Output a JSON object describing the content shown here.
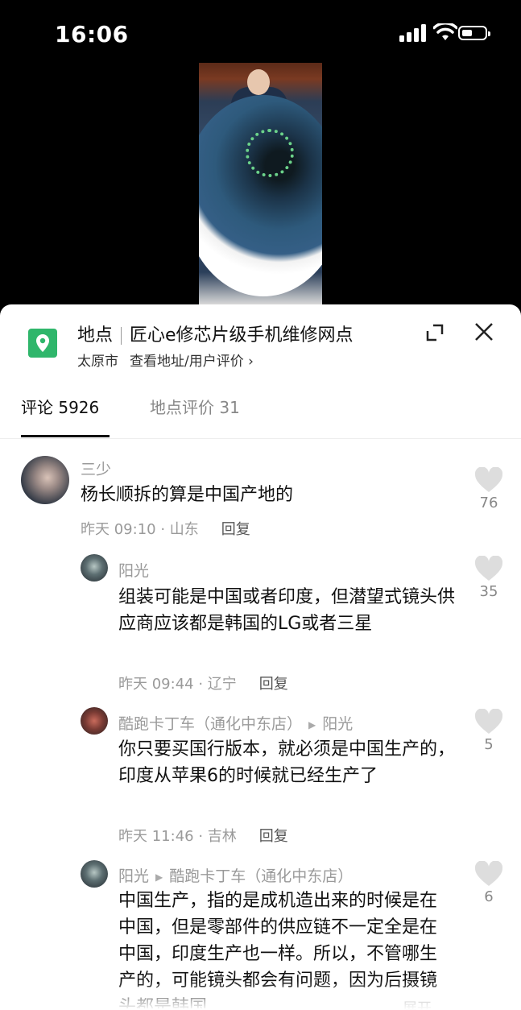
{
  "status_bar": {
    "time": "16:06"
  },
  "location": {
    "prefix": "地点",
    "name": "匠心e修芯片级手机维修网点",
    "city": "太原市",
    "link": "查看地址/用户评价",
    "link_chevron": "›"
  },
  "tabs": [
    {
      "label": "评论 5926"
    },
    {
      "label": "地点评价 31"
    }
  ],
  "comments": [
    {
      "user": "三少",
      "text": "杨长顺拆的算是中国产地的",
      "time_place": "昨天 09:10 · 山东",
      "reply": "回复",
      "likes": "76"
    },
    {
      "user": "阳光",
      "text": "组装可能是中国或者印度，但潜望式镜头供应商应该都是韩国的LG或者三星",
      "time_place": "昨天 09:44 · 辽宁",
      "reply": "回复",
      "likes": "35"
    },
    {
      "user": "酷跑卡丁车（通化中东店）",
      "reply_to": "阳光",
      "text": "你只要买国行版本，就必须是中国生产的，印度从苹果6的时候就已经生产了",
      "time_place": "昨天 11:46 · 吉林",
      "reply": "回复",
      "likes": "5"
    },
    {
      "user": "阳光",
      "reply_to": "酷跑卡丁车（通化中东店）",
      "text": "中国生产，指的是成机造出来的时候是在中国，但是零部件的供应链不一定全是在中国，印度生产也一样。所以，不管哪生产的，可能镜头都会有问题，因为后摄镜头都是韩国",
      "expand": "展开",
      "likes": "6"
    }
  ],
  "colors": {
    "accent_green": "#2fb66b",
    "muted": "#9a9a9a"
  },
  "icons": [
    "location-pin-icon",
    "expand-icon",
    "close-icon",
    "heart-icon",
    "signal-icon",
    "wifi-icon",
    "battery-icon"
  ]
}
